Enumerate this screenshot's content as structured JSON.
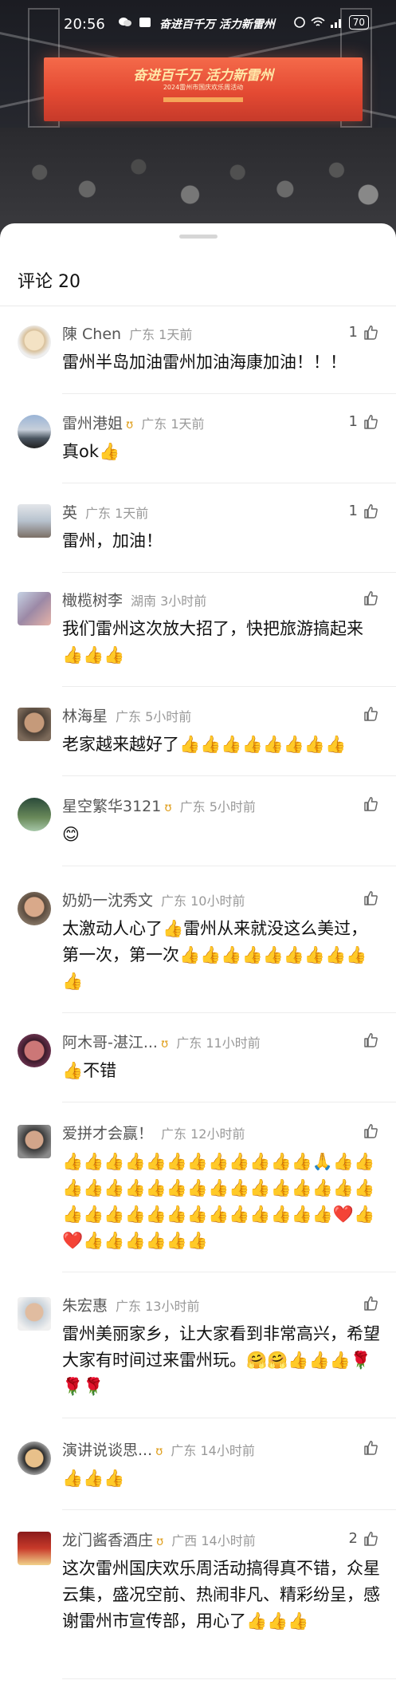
{
  "status": {
    "time": "20:56",
    "banner": "奋进百千万  活力新雷州",
    "battery": "70"
  },
  "stage": {
    "title": "奋进百千万  活力新雷州",
    "subtitle": "2024雷州市国庆欢乐周活动"
  },
  "sheet": {
    "title": "评论 20"
  },
  "comments": [
    {
      "name": "陳 Chen",
      "badge": "",
      "meta": "广东 1天前",
      "likes": "1",
      "text": "雷州半岛加油雷州加油海康加油！！！"
    },
    {
      "name": "雷州港姐",
      "badge": "ʊ",
      "meta": "广东 1天前",
      "likes": "1",
      "text": "真ok👍"
    },
    {
      "name": "英",
      "badge": "",
      "meta": "广东 1天前",
      "likes": "1",
      "text": "雷州，加油！"
    },
    {
      "name": "橄榄树李",
      "badge": "",
      "meta": "湖南 3小时前",
      "likes": "",
      "text": "我们雷州这次放大招了，快把旅游搞起来👍👍👍"
    },
    {
      "name": "林海星",
      "badge": "",
      "meta": "广东 5小时前",
      "likes": "",
      "text": "老家越来越好了👍👍👍👍👍👍👍👍"
    },
    {
      "name": "星空繁华3121",
      "badge": "ʊ",
      "meta": "广东 5小时前",
      "likes": "",
      "text": "😊"
    },
    {
      "name": "奶奶一沈秀文",
      "badge": "",
      "meta": "广东 10小时前",
      "likes": "",
      "text": "太激动人心了👍雷州从来就没这么美过，第一次，第一次👍👍👍👍👍👍👍👍👍👍"
    },
    {
      "name": "阿木哥-湛江...",
      "badge": "ʊ",
      "meta": "广东 11小时前",
      "likes": "",
      "text": "👍不错"
    },
    {
      "name": "爱拼才会赢！",
      "badge": "",
      "meta": "广东 12小时前",
      "likes": "",
      "text": "👍👍👍👍👍👍👍👍👍👍👍👍🙏👍👍👍👍👍👍👍👍👍👍👍👍👍👍👍👍👍👍👍👍👍👍👍👍👍👍👍👍👍👍❤️👍❤️👍👍👍👍👍👍"
    },
    {
      "name": "朱宏惠",
      "badge": "",
      "meta": "广东 13小时前",
      "likes": "",
      "text": "雷州美丽家乡，让大家看到非常高兴，希望大家有时间过来雷州玩。🤗🤗👍👍👍🌹🌹🌹"
    },
    {
      "name": "演讲说谈思...",
      "badge": "ʊ",
      "meta": "广东 14小时前",
      "likes": "",
      "text": "👍👍👍"
    },
    {
      "name": "龙门酱香酒庄",
      "badge": "ʊ",
      "meta": "广西 14小时前",
      "likes": "2",
      "text": "这次雷州国庆欢乐周活动搞得真不错，众星云集，盛况空前、热闹非凡、精彩纷呈，感谢雷州市宣传部，用心了👍👍👍"
    }
  ]
}
